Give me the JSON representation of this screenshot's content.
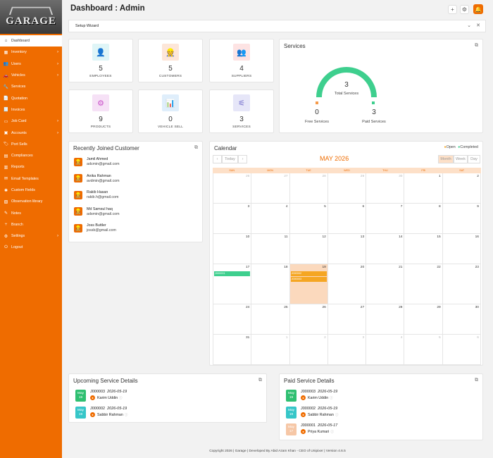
{
  "app": {
    "logo_text": "GARAGE"
  },
  "sidebar": {
    "items": [
      {
        "label": "Dashboard",
        "icon": "home-icon",
        "active": true,
        "has_children": false
      },
      {
        "label": "Inventory",
        "icon": "inventory-icon",
        "active": false,
        "has_children": true
      },
      {
        "label": "Users",
        "icon": "users-icon",
        "active": false,
        "has_children": true
      },
      {
        "label": "Vehicles",
        "icon": "car-icon",
        "active": false,
        "has_children": true
      },
      {
        "label": "Services",
        "icon": "wrench-icon",
        "active": false,
        "has_children": false
      },
      {
        "label": "Quotation",
        "icon": "document-icon",
        "active": false,
        "has_children": false
      },
      {
        "label": "Invoices",
        "icon": "invoice-icon",
        "active": false,
        "has_children": false
      },
      {
        "label": "Job Card",
        "icon": "card-icon",
        "active": false,
        "has_children": true
      },
      {
        "label": "Accounts",
        "icon": "accounts-icon",
        "active": false,
        "has_children": true
      },
      {
        "label": "Port Sells",
        "icon": "tag-icon",
        "active": false,
        "has_children": false
      },
      {
        "label": "Compliances",
        "icon": "compliance-icon",
        "active": false,
        "has_children": false
      },
      {
        "label": "Reports",
        "icon": "chart-icon",
        "active": false,
        "has_children": false
      },
      {
        "label": "Email Templates",
        "icon": "email-icon",
        "active": false,
        "has_children": false
      },
      {
        "label": "Custom Fields",
        "icon": "fields-icon",
        "active": false,
        "has_children": false
      },
      {
        "label": "Observation library",
        "icon": "library-icon",
        "active": false,
        "has_children": false
      },
      {
        "label": "Notes",
        "icon": "notes-icon",
        "active": false,
        "has_children": false
      },
      {
        "label": "Branch",
        "icon": "branch-icon",
        "active": false,
        "has_children": false
      },
      {
        "label": "Settings",
        "icon": "gear-icon",
        "active": false,
        "has_children": true
      },
      {
        "label": "Logout",
        "icon": "power-icon",
        "active": false,
        "has_children": false
      }
    ]
  },
  "header": {
    "title": "Dashboard : Admin",
    "buttons": [
      "plus-icon",
      "gear-icon",
      "bell-icon"
    ]
  },
  "wizard": {
    "label": "Setup Wizard"
  },
  "stats": [
    {
      "value": "5",
      "label": "EMPLOYEES",
      "icon": "employee-icon",
      "bg": "#dff5f7",
      "color": "#26b5c5"
    },
    {
      "value": "5",
      "label": "CUSTOMERS",
      "icon": "customer-icon",
      "bg": "#fde6d8",
      "color": "#ef8a52"
    },
    {
      "value": "4",
      "label": "SUPPLIERS",
      "icon": "supplier-icon",
      "bg": "#fde3e3",
      "color": "#e0515b"
    },
    {
      "value": "9",
      "label": "PRODUCTS",
      "icon": "product-icon",
      "bg": "#f6e1f6",
      "color": "#c94fc9"
    },
    {
      "value": "0",
      "label": "VEHICLE SELL",
      "icon": "vehicle-sell-icon",
      "bg": "#dfeefb",
      "color": "#2f7fd0"
    },
    {
      "value": "3",
      "label": "SERVICES",
      "icon": "services-icon",
      "bg": "#e6e6f8",
      "color": "#6a64c8"
    }
  ],
  "services": {
    "title": "Services",
    "total": "3",
    "total_label": "Total Services",
    "free": "0",
    "free_label": "Free Services",
    "paid": "3",
    "paid_label": "Paid Services",
    "gauge_fraction": 1.0,
    "colors": {
      "gauge": "#3ecf8e",
      "free": "#f59a4a",
      "paid": "#3ecf8e"
    }
  },
  "customers": {
    "title": "Recently Joined Customer",
    "list": [
      {
        "name": "Jamil Ahmed",
        "email": "adcmin@gmail.com"
      },
      {
        "name": "Anika Rahman",
        "email": "avdmin@gmail.com"
      },
      {
        "name": "Rakib Hasan",
        "email": "rakib.h@gmail.com"
      },
      {
        "name": "Md Samsul haq",
        "email": "adsmin@gmail.com"
      },
      {
        "name": "Joss Buttler",
        "email": "jossb@gmail.com"
      }
    ]
  },
  "calendar": {
    "title": "Calendar",
    "month_label": "MAY 2026",
    "today_label": "Today",
    "views": [
      "Month",
      "Week",
      "Day"
    ],
    "legend": {
      "open": "Open",
      "completed": "Completed"
    },
    "colors": {
      "open": "#f5a623",
      "completed": "#3ecf8e"
    },
    "weekdays": [
      "SUN",
      "MON",
      "TUE",
      "WED",
      "THU",
      "FRI",
      "SAT"
    ],
    "weeks": [
      [
        {
          "d": "26",
          "o": true
        },
        {
          "d": "27",
          "o": true
        },
        {
          "d": "28",
          "o": true
        },
        {
          "d": "29",
          "o": true
        },
        {
          "d": "30",
          "o": true
        },
        {
          "d": "1"
        },
        {
          "d": "2"
        }
      ],
      [
        {
          "d": "3"
        },
        {
          "d": "4"
        },
        {
          "d": "5"
        },
        {
          "d": "6"
        },
        {
          "d": "7"
        },
        {
          "d": "8"
        },
        {
          "d": "9"
        }
      ],
      [
        {
          "d": "10"
        },
        {
          "d": "11"
        },
        {
          "d": "12"
        },
        {
          "d": "13"
        },
        {
          "d": "14"
        },
        {
          "d": "15"
        },
        {
          "d": "16"
        }
      ],
      [
        {
          "d": "17",
          "events": [
            {
              "label": "J000001",
              "status": "completed"
            }
          ]
        },
        {
          "d": "18"
        },
        {
          "d": "19",
          "today": true,
          "events": [
            {
              "label": "J000002",
              "status": "open"
            },
            {
              "label": "J000003",
              "status": "open"
            }
          ]
        },
        {
          "d": "20"
        },
        {
          "d": "21"
        },
        {
          "d": "22"
        },
        {
          "d": "23"
        }
      ],
      [
        {
          "d": "24"
        },
        {
          "d": "25"
        },
        {
          "d": "26"
        },
        {
          "d": "27"
        },
        {
          "d": "28"
        },
        {
          "d": "29"
        },
        {
          "d": "30"
        }
      ],
      [
        {
          "d": "31"
        },
        {
          "d": "1",
          "o": true
        },
        {
          "d": "2",
          "o": true
        },
        {
          "d": "3",
          "o": true
        },
        {
          "d": "4",
          "o": true
        },
        {
          "d": "5",
          "o": true
        },
        {
          "d": "6",
          "o": true
        }
      ]
    ]
  },
  "upcoming": {
    "title": "Upcoming Service Details",
    "items": [
      {
        "month": "May",
        "day": "19",
        "code": "J000003",
        "date": "2026-05-19",
        "person": "Karim Uddin",
        "color": "#2fbf71"
      },
      {
        "month": "May",
        "day": "19",
        "code": "J000002",
        "date": "2026-05-19",
        "person": "Sabbir Rahman",
        "color": "#36c6c8"
      }
    ]
  },
  "paid": {
    "title": "Paid Service Details",
    "items": [
      {
        "month": "May",
        "day": "19",
        "code": "J000003",
        "date": "2026-05-19",
        "person": "Karim Uddin",
        "color": "#2fbf71"
      },
      {
        "month": "May",
        "day": "19",
        "code": "J000002",
        "date": "2026-05-19",
        "person": "Sabbir Rahman",
        "color": "#36c6c8"
      },
      {
        "month": "May",
        "day": "17",
        "code": "J000001",
        "date": "2026-05-17",
        "person": "Priya Kumari",
        "color": "#f6c7a6"
      }
    ]
  },
  "footer": {
    "text": "Copyright 2026 | Garage | Developed By Abid Azam Khan - CEO of Unipixer | Version 4.6.5"
  }
}
